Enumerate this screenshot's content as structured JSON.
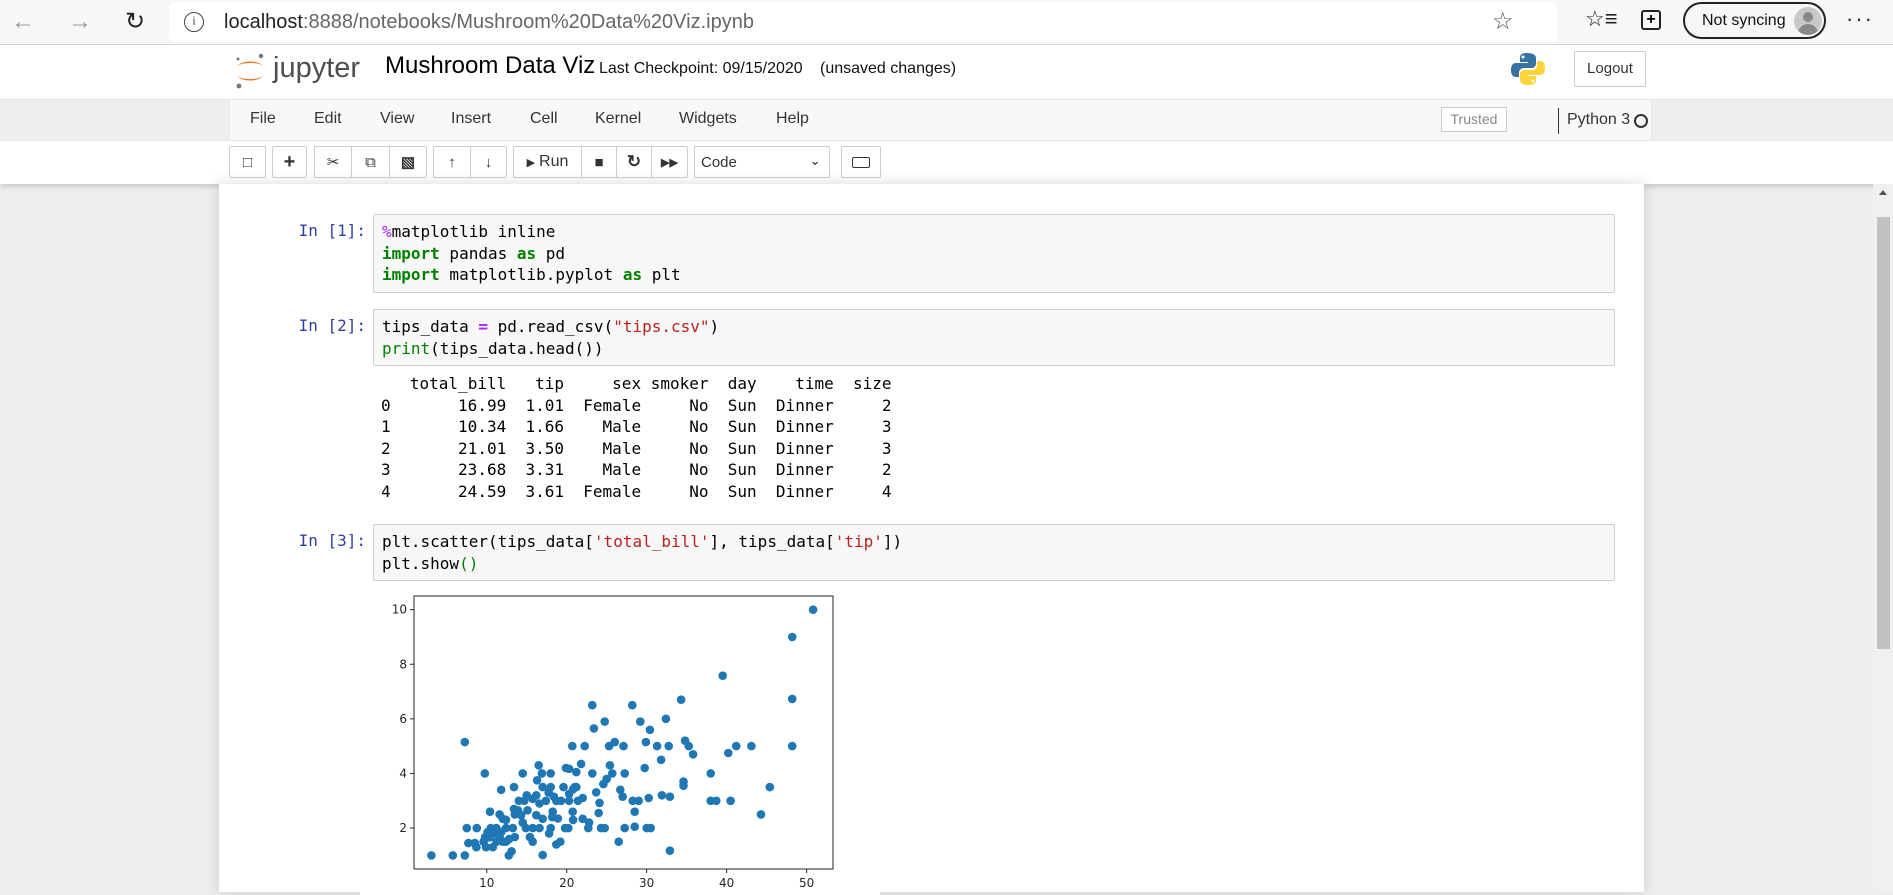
{
  "browser": {
    "url_host": "localhost",
    "url_rest": ":8888/notebooks/Mushroom%20Data%20Viz.ipynb",
    "sync_label": "Not syncing"
  },
  "header": {
    "logo_text": "jupyter",
    "notebook_title": "Mushroom Data Viz",
    "checkpoint": "Last Checkpoint: 09/15/2020",
    "unsaved": "(unsaved changes)",
    "logout": "Logout"
  },
  "menu": {
    "items": [
      "File",
      "Edit",
      "View",
      "Insert",
      "Cell",
      "Kernel",
      "Widgets",
      "Help"
    ],
    "trusted": "Trusted",
    "kernel": "Python 3"
  },
  "toolbar": {
    "run_label": "Run",
    "cell_type": "Code"
  },
  "cells": [
    {
      "prompt": "In [1]:",
      "lines": [
        [
          [
            "%",
            "m"
          ],
          [
            "matplotlib inline",
            "p"
          ]
        ],
        [
          [
            "import",
            "k"
          ],
          [
            " pandas ",
            "p"
          ],
          [
            "as",
            "k"
          ],
          [
            " pd",
            "p"
          ]
        ],
        [
          [
            "import",
            "k"
          ],
          [
            " matplotlib.pyplot ",
            "p"
          ],
          [
            "as",
            "k"
          ],
          [
            " plt",
            "p"
          ]
        ]
      ]
    },
    {
      "prompt": "In [2]:",
      "lines": [
        [
          [
            "tips_data ",
            "p"
          ],
          [
            "=",
            "o"
          ],
          [
            " pd.read_csv(",
            "p"
          ],
          [
            "\"tips.csv\"",
            "s"
          ],
          [
            ")",
            "p"
          ]
        ],
        [
          [
            "print",
            "b"
          ],
          [
            "(tips_data.head())",
            "p"
          ]
        ]
      ]
    },
    {
      "prompt": "In [3]:",
      "lines": [
        [
          [
            "plt.scatter(tips_data[",
            "p"
          ],
          [
            "'total_bill'",
            "s"
          ],
          [
            "], tips_data[",
            "p"
          ],
          [
            "'tip'",
            "s"
          ],
          [
            "])",
            "p"
          ]
        ],
        [
          [
            "plt.show",
            "p"
          ],
          [
            "()",
            "b"
          ]
        ]
      ]
    }
  ],
  "output_table": {
    "columns": [
      "",
      "total_bill",
      "tip",
      "sex",
      "smoker",
      "day",
      "time",
      "size"
    ],
    "rows": [
      [
        "0",
        "16.99",
        "1.01",
        "Female",
        "No",
        "Sun",
        "Dinner",
        "2"
      ],
      [
        "1",
        "10.34",
        "1.66",
        "Male",
        "No",
        "Sun",
        "Dinner",
        "3"
      ],
      [
        "2",
        "21.01",
        "3.50",
        "Male",
        "No",
        "Sun",
        "Dinner",
        "3"
      ],
      [
        "3",
        "23.68",
        "3.31",
        "Male",
        "No",
        "Sun",
        "Dinner",
        "2"
      ],
      [
        "4",
        "24.59",
        "3.61",
        "Female",
        "No",
        "Sun",
        "Dinner",
        "4"
      ]
    ]
  },
  "chart_data": {
    "type": "scatter",
    "title": "",
    "xlabel": "",
    "ylabel": "",
    "xlim": [
      0.9,
      53.3
    ],
    "ylim": [
      0.5,
      10.5
    ],
    "xticks": [
      10,
      20,
      30,
      40,
      50
    ],
    "yticks": [
      2,
      4,
      6,
      8,
      10
    ],
    "color": "#1f77b4",
    "points": [
      [
        3.07,
        1.0
      ],
      [
        5.75,
        1.0
      ],
      [
        7.25,
        1.0
      ],
      [
        7.25,
        5.15
      ],
      [
        7.5,
        2.0
      ],
      [
        7.7,
        1.45
      ],
      [
        8.75,
        2.0
      ],
      [
        8.7,
        1.3
      ],
      [
        9.75,
        4.0
      ],
      [
        10.4,
        2.6
      ],
      [
        11.8,
        3.4
      ],
      [
        13.4,
        3.5
      ],
      [
        14.5,
        4.0
      ],
      [
        12.75,
        1.0
      ],
      [
        13.1,
        1.15
      ],
      [
        16.5,
        4.3
      ],
      [
        16.99,
        1.01
      ],
      [
        18.0,
        4.0
      ],
      [
        18.7,
        1.4
      ],
      [
        19.2,
        1.5
      ],
      [
        19.9,
        4.2
      ],
      [
        20.7,
        5.0
      ],
      [
        22.25,
        5.0
      ],
      [
        21.8,
        4.35
      ],
      [
        23.2,
        6.5
      ],
      [
        23.4,
        5.65
      ],
      [
        24.75,
        5.9
      ],
      [
        25.3,
        5.0
      ],
      [
        26.0,
        5.15
      ],
      [
        27.1,
        5.0
      ],
      [
        27.25,
        4.0
      ],
      [
        26.5,
        1.5
      ],
      [
        27.25,
        2.0
      ],
      [
        28.2,
        6.5
      ],
      [
        29.2,
        5.9
      ],
      [
        29.9,
        5.15
      ],
      [
        30.4,
        5.6
      ],
      [
        29.75,
        4.2
      ],
      [
        30.25,
        3.1
      ],
      [
        31.3,
        5.0
      ],
      [
        31.8,
        4.5
      ],
      [
        32.4,
        6.0
      ],
      [
        32.75,
        5.0
      ],
      [
        32.9,
        1.17
      ],
      [
        31.9,
        3.2
      ],
      [
        32.9,
        3.15
      ],
      [
        34.3,
        6.7
      ],
      [
        34.8,
        5.2
      ],
      [
        35.25,
        5.0
      ],
      [
        35.8,
        4.7
      ],
      [
        34.6,
        3.7
      ],
      [
        34.6,
        3.55
      ],
      [
        38.0,
        4.0
      ],
      [
        38.0,
        3.0
      ],
      [
        38.7,
        3.0
      ],
      [
        39.5,
        7.58
      ],
      [
        40.2,
        4.75
      ],
      [
        41.2,
        5.0
      ],
      [
        40.5,
        3.0
      ],
      [
        43.1,
        5.0
      ],
      [
        44.3,
        2.5
      ],
      [
        45.4,
        3.5
      ],
      [
        48.2,
        9.0
      ],
      [
        48.2,
        6.73
      ],
      [
        48.2,
        5.0
      ],
      [
        50.81,
        10.0
      ],
      [
        28.25,
        3.0
      ],
      [
        29.0,
        3.0
      ],
      [
        28.5,
        2.6
      ],
      [
        28.5,
        2.05
      ],
      [
        30.0,
        2.0
      ],
      [
        30.5,
        2.0
      ],
      [
        26.7,
        3.4
      ],
      [
        27.0,
        3.15
      ],
      [
        24.1,
        2.92
      ],
      [
        24.0,
        2.55
      ],
      [
        24.3,
        2.0
      ],
      [
        24.75,
        2.0
      ],
      [
        22.8,
        2.2
      ],
      [
        22.7,
        2.0
      ],
      [
        25.4,
        4.3
      ],
      [
        25.7,
        4.0
      ],
      [
        23.2,
        4.0
      ],
      [
        24.59,
        3.61
      ],
      [
        25.0,
        3.8
      ],
      [
        23.68,
        3.31
      ],
      [
        21.01,
        3.5
      ],
      [
        22.0,
        3.1
      ],
      [
        20.75,
        2.6
      ],
      [
        20.8,
        2.3
      ],
      [
        20.2,
        2.0
      ],
      [
        19.8,
        2.0
      ],
      [
        19.6,
        3.5
      ],
      [
        20.3,
        3.0
      ],
      [
        21.2,
        3.5
      ],
      [
        21.4,
        3.0
      ],
      [
        19.3,
        3.0
      ],
      [
        18.7,
        3.0
      ],
      [
        18.0,
        3.5
      ],
      [
        18.25,
        2.6
      ],
      [
        18.2,
        2.4
      ],
      [
        18.9,
        2.35
      ],
      [
        18.0,
        2.0
      ],
      [
        17.8,
        1.8
      ],
      [
        17.4,
        3.0
      ],
      [
        17.0,
        3.5
      ],
      [
        16.9,
        4.0
      ],
      [
        16.3,
        3.75
      ],
      [
        16.2,
        3.2
      ],
      [
        15.75,
        3.07
      ],
      [
        15.0,
        3.2
      ],
      [
        14.7,
        3.0
      ],
      [
        14.0,
        3.0
      ],
      [
        13.4,
        2.7
      ],
      [
        13.5,
        2.5
      ],
      [
        14.3,
        2.47
      ],
      [
        14.9,
        2.0
      ],
      [
        15.75,
        2.0
      ],
      [
        16.2,
        2.47
      ],
      [
        16.6,
        2.0
      ],
      [
        15.4,
        1.67
      ],
      [
        15.75,
        1.5
      ],
      [
        13.5,
        1.67
      ],
      [
        13.25,
        2.0
      ],
      [
        12.4,
        2.0
      ],
      [
        12.0,
        2.34
      ],
      [
        11.6,
        2.5
      ],
      [
        12.4,
        2.3
      ],
      [
        11.2,
        2.0
      ],
      [
        10.5,
        2.0
      ],
      [
        10.1,
        1.85
      ],
      [
        9.8,
        1.67
      ],
      [
        9.6,
        1.5
      ],
      [
        9.9,
        1.3
      ],
      [
        10.75,
        1.3
      ],
      [
        11.2,
        1.5
      ],
      [
        11.6,
        1.67
      ],
      [
        12.0,
        1.5
      ],
      [
        12.4,
        1.5
      ],
      [
        12.8,
        1.6
      ],
      [
        11.0,
        1.8
      ],
      [
        11.8,
        1.85
      ],
      [
        8.5,
        1.45
      ],
      [
        10.34,
        1.66
      ],
      [
        14.5,
        2.2
      ],
      [
        17.0,
        2.34
      ],
      [
        20.3,
        3.25
      ],
      [
        20.8,
        3.42
      ],
      [
        17.75,
        3.3
      ],
      [
        18.4,
        3.15
      ],
      [
        16.6,
        2.9
      ],
      [
        15.1,
        2.65
      ],
      [
        13.9,
        2.65
      ],
      [
        21.2,
        4.05
      ],
      [
        20.3,
        4.17
      ],
      [
        22.0,
        2.34
      ]
    ]
  }
}
